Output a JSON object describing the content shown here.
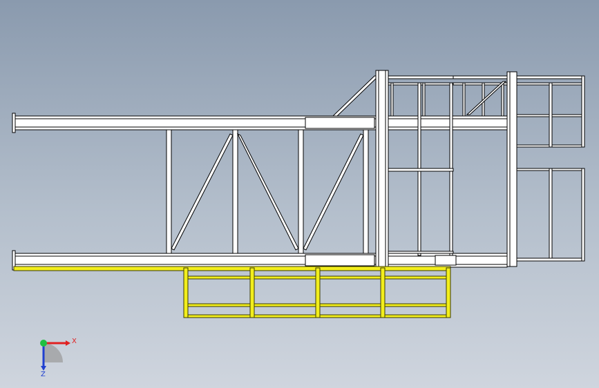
{
  "triad": {
    "x_label": "X",
    "z_label": "Z",
    "x_color": "#e02020",
    "z_color": "#2040d0",
    "y_color": "#20c040"
  },
  "colors": {
    "steel_fill": "#ffffff",
    "steel_stroke": "#000000",
    "rail_fill": "#f2ee1c",
    "rail_stroke": "#4a4a00",
    "background_top": "#8a9aae",
    "background_bottom": "#cfd5de"
  }
}
